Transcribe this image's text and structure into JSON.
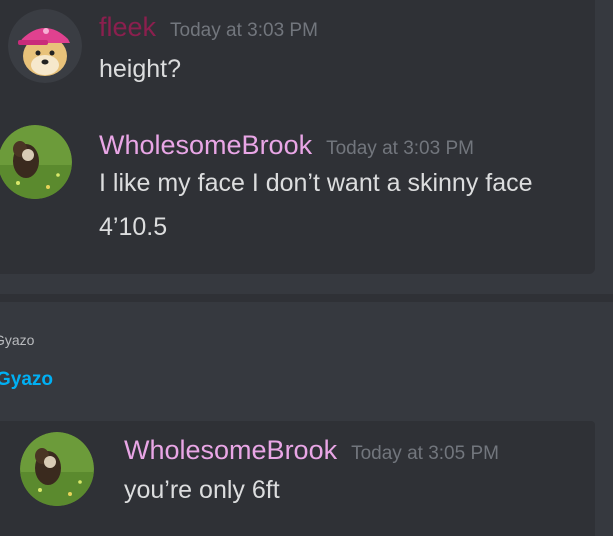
{
  "messages_top": [
    {
      "username": "fleek",
      "username_color": "#8b1f4e",
      "timestamp": "Today at 3:03 PM",
      "lines": [
        "height?"
      ],
      "avatar": "doge-pink-hat-avatar"
    },
    {
      "username": "WholesomeBrook",
      "username_color": "#e9a6e6",
      "timestamp": "Today at 3:03 PM",
      "lines": [
        "I like my face I don’t want a skinny face",
        "4’10.5"
      ],
      "avatar": "dog-grass-avatar"
    }
  ],
  "embed": {
    "provider": "Gyazo",
    "title": "Gyazo",
    "title_color": "#00b0f4"
  },
  "message_bottom": {
    "username": "WholesomeBrook",
    "username_color": "#e9a6e6",
    "timestamp": "Today at 3:05 PM",
    "lines": [
      "you’re only 6ft"
    ],
    "avatar": "dog-grass-avatar"
  }
}
